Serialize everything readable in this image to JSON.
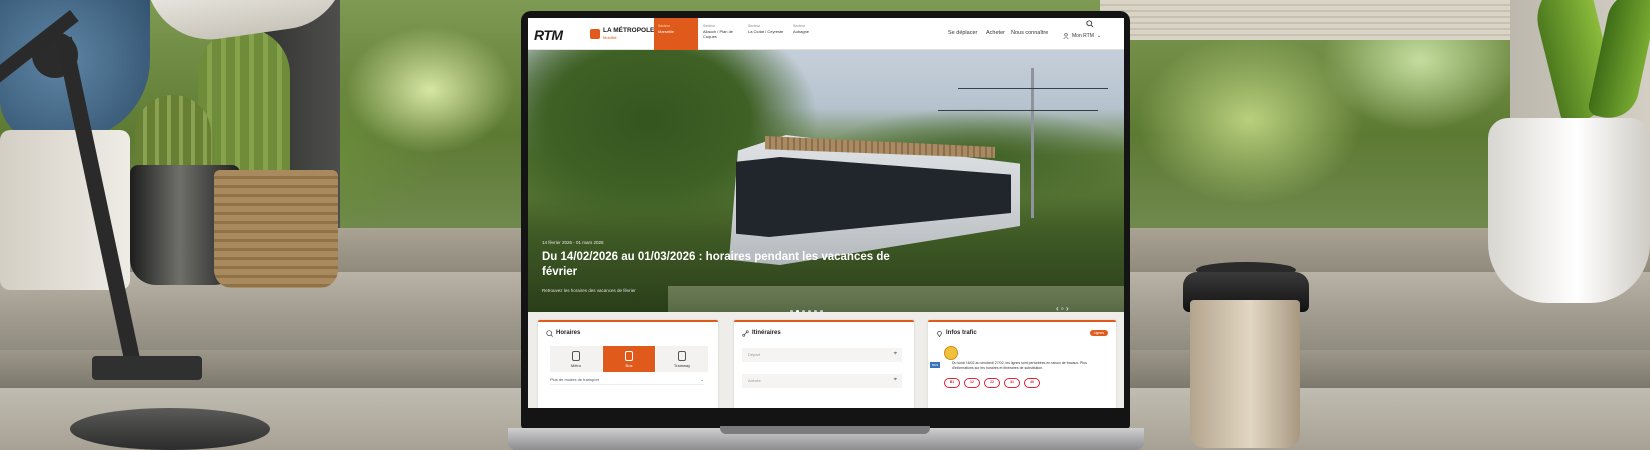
{
  "site": {
    "logo": "RTM",
    "partner": {
      "name": "LA MÉTROPOLE",
      "sub": "Mobilité"
    }
  },
  "sectors": [
    {
      "top": "Secteur",
      "label": "Marseille",
      "active": true
    },
    {
      "top": "Secteur",
      "label": "Allauch / Plan de Cuques",
      "active": false
    },
    {
      "top": "Secteur",
      "label": "La Ciotat / Ceyreste",
      "active": false
    },
    {
      "top": "Secteur",
      "label": "Aubagne",
      "active": false
    }
  ],
  "nav": {
    "links": [
      "Se déplacer",
      "Acheter",
      "Nous connaître"
    ],
    "account": "Mon RTM"
  },
  "hero": {
    "date": "14 février 2026 - 01 mars 2026",
    "title": "Du 14/02/2026 au 01/03/2026 : horaires pendant les vacances de février",
    "subtitle": "Retrouvez les horaires des vacances de février",
    "slides": 6,
    "active_slide": 2
  },
  "cards": {
    "horaires": {
      "title": "Horaires",
      "modes": [
        {
          "label": "Métro",
          "active": false
        },
        {
          "label": "Bus",
          "active": true
        },
        {
          "label": "Tramway",
          "active": false
        }
      ],
      "select_placeholder": "Plus de modes de transport"
    },
    "itineraires": {
      "title": "Itinéraires",
      "from_placeholder": "Départ",
      "to_placeholder": "Arrivée"
    },
    "trafic": {
      "title": "Infos trafic",
      "badge": "Lignes",
      "alert_tag": "BUS",
      "alert_text": "Du lundi 16/02 au vendredi 27/02, les lignes sont perturbées en raison de travaux. Plus d'informations sur les horaires et itinéraires de substitution.",
      "lines": [
        "B1",
        "12",
        "22",
        "31",
        "40"
      ]
    }
  }
}
